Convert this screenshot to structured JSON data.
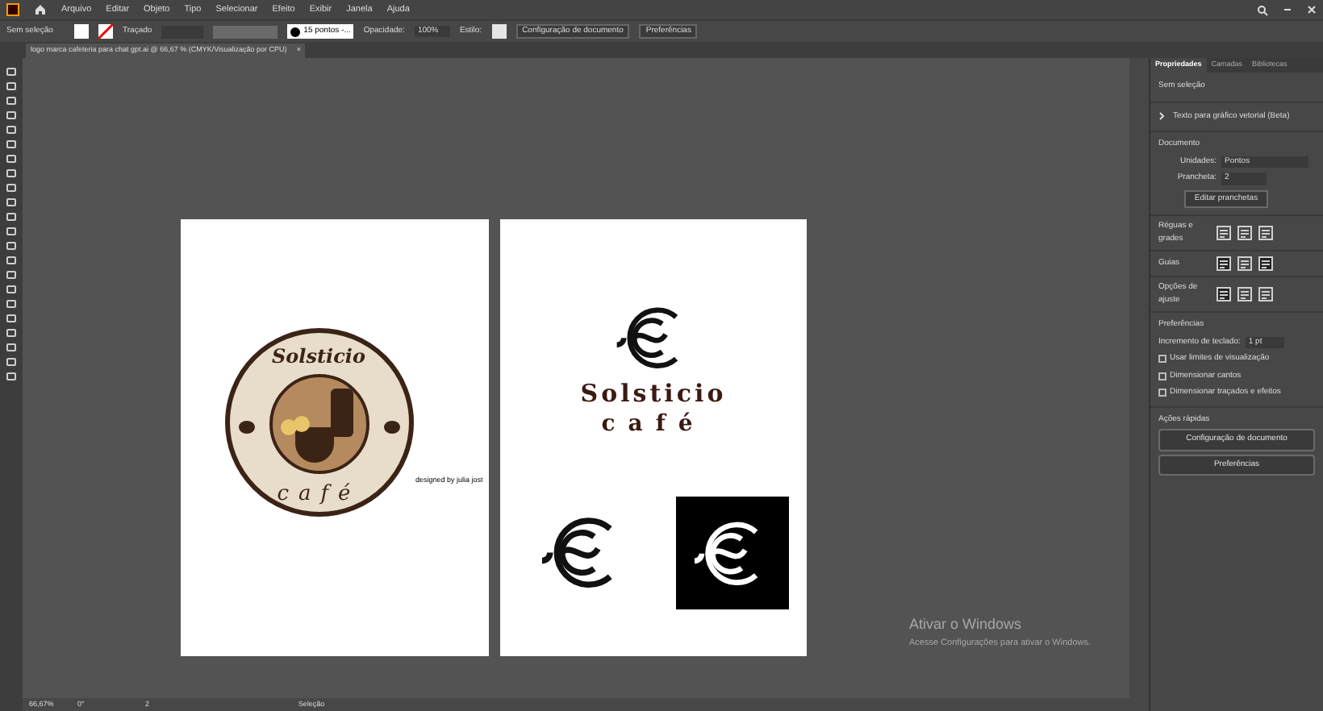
{
  "menu": [
    "Arquivo",
    "Editar",
    "Objeto",
    "Tipo",
    "Selecionar",
    "Efeito",
    "Exibir",
    "Janela",
    "Ajuda"
  ],
  "control_bar": {
    "selection": "Sem seleção",
    "stroke_label": "Traçado",
    "brush": "15 pontos -...",
    "opacity_label": "Opacidade:",
    "opacity": "100%",
    "style_label": "Estilo:",
    "buttons": [
      "Configuração de documento",
      "Preferências"
    ]
  },
  "document_tab": {
    "title": "logo marca cafeteria para chat gpt.ai @ 66,67 % (CMYK/Visualização por CPU)",
    "close": "×"
  },
  "artboards": [
    {
      "kind": "badge",
      "title": "Solsticio",
      "subtitle": "café",
      "credit": "designed by julia jost"
    },
    {
      "kind": "mark",
      "title": "Solsticio",
      "subtitle": "café"
    }
  ],
  "panel": {
    "tabs": [
      {
        "label": "Propriedades",
        "selected": true
      },
      {
        "label": "Camadas",
        "selected": false
      },
      {
        "label": "Bibliotecas",
        "selected": false
      }
    ],
    "selection": "Sem seleção",
    "vector_text": "Texto para gráfico vetorial (Beta)",
    "document": {
      "heading": "Documento",
      "units_label": "Unidades:",
      "units": "Pontos",
      "artboards_label": "Prancheta:",
      "artboard": "2",
      "edit_button": "Editar pranchetas"
    },
    "rulers_label": "Réguas e grades",
    "guides_label": "Guias",
    "snap_label": "Opções de ajuste",
    "preferences": {
      "heading": "Preferências",
      "key_increment_label": "Incremento de teclado:",
      "key_increment": "1 pt",
      "options": [
        {
          "label": "Usar limites de visualização",
          "checked": false
        },
        {
          "label": "Dimensionar cantos",
          "checked": false
        },
        {
          "label": "Dimensionar traçados e efeitos",
          "checked": false
        }
      ]
    },
    "quick_actions": {
      "heading": "Ações rápidas",
      "buttons": [
        "Configuração de documento",
        "Preferências"
      ]
    }
  },
  "status_bar": {
    "zoom": "66,67%",
    "rotation": "0°",
    "artboard": "2",
    "tool": "Seleção"
  },
  "activation_notice": {
    "title": "Ativar o Windows",
    "text": "Acesse Configurações para ativar o Windows."
  }
}
